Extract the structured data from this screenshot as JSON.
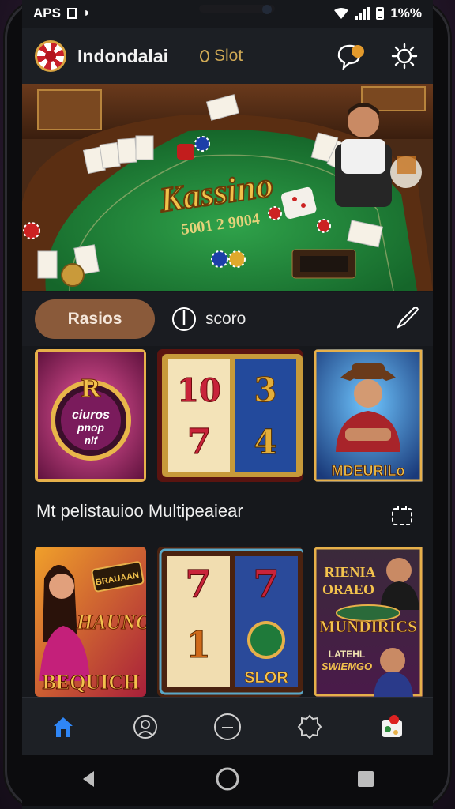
{
  "status_bar": {
    "left_text": "APS",
    "right_text": "1%%"
  },
  "header": {
    "app_title": "Indondalai",
    "slot_label": "Slot"
  },
  "hero": {
    "title": "Kassino",
    "subtitle": "5001 2 9004"
  },
  "chips": {
    "active_label": "Rasios",
    "score_label": "scoro"
  },
  "row1": [
    {
      "name": "tile-a",
      "lines": [
        "ciuros",
        "pnop",
        "nif"
      ]
    },
    {
      "name": "slot-reels",
      "reels": [
        "10",
        "3",
        "7",
        "4"
      ]
    },
    {
      "name": "cowboy",
      "caption": "MDEURILo"
    }
  ],
  "section": {
    "title": "Mt pelistauioo Multipeaiear"
  },
  "row2": [
    {
      "name": "woman-game",
      "badge": "HAUNO",
      "banner": "BRAUAAN",
      "caption": "BEQUICH"
    },
    {
      "name": "slot-777",
      "reels": [
        "7",
        "7",
        "1"
      ],
      "caption": "SLOR"
    },
    {
      "name": "mundirics",
      "title_line1": "RIENIA",
      "title_line2": "ORAEO",
      "caption": "MUNDIRICS",
      "sub1": "LATEHL",
      "sub2": "SWIEMGO"
    }
  ],
  "colors": {
    "accent_chip": "#8a5a3a",
    "gold": "#d9a441",
    "nav_active": "#2f86f6",
    "felt": "#1f8a3a"
  },
  "icons": {
    "header": [
      "chat-bubble-icon",
      "settings-gear-icon"
    ],
    "nav": [
      "home-icon",
      "profile-icon",
      "chat-icon",
      "badge-icon",
      "games-icon"
    ],
    "system": [
      "back-icon",
      "home-button-icon",
      "recents-icon"
    ]
  }
}
